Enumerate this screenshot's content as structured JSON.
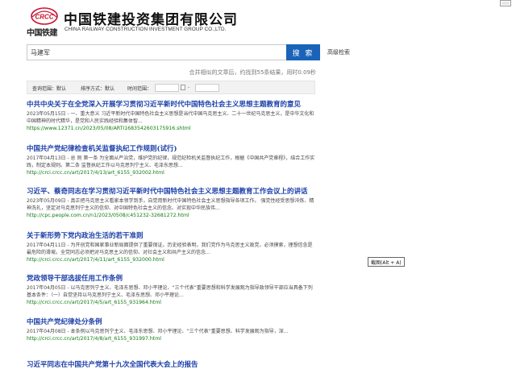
{
  "header": {
    "logo_text": "中国铁建",
    "logo_emblem_text": "CRCC",
    "company_cn": "中国铁建投资集团有限公司",
    "company_en": "CHINA RAILWAY CONSTRUCTION INVESTMENT GROUP CO.,LTD."
  },
  "search": {
    "query": "马建军",
    "button_label": "搜 索",
    "advanced_label": "高级检索"
  },
  "stats_text": "合并相似的文章后，约找到55条结果，用时0.09秒",
  "filters": {
    "scope_label": "查询范围：默认",
    "sort_label": "排序方式：默认",
    "time_label": "时间范围：",
    "date_separator": "-"
  },
  "results": [
    {
      "title": "中共中央关于在全党深入开展学习贯彻习近平新时代中国特色社会主义思想主题教育的意见",
      "snippet": "2023年05月15日 - 一、重大意义 习近平新时代中国特色社会主义思想是当代中国马克思主义、二十一世纪马克思主义，是中华文化和中国精神的时代精华，是党和人民实践经验和集体智...",
      "url": "https://www.12371.cn/2023/05/08/ARTI1683542603175916.shtml"
    },
    {
      "title": "中国共产党纪律检查机关监督执纪工作规则(试行)",
      "snippet": "2017年04月13日 - 总 则 第一条 为全面从严治党，维护党的纪律，规范纪检机关监督执纪工作，根据《中国共产党章程》，结合工作实践，制定本规则。第二条 监督执纪工作以马克思列宁主义、毛泽东思想...",
      "url": "http://crci.crcc.cn/art/2017/4/13/art_6155_932002.html"
    },
    {
      "title": "习近平、蔡奇同志在学习贯彻习近平新时代中国特色社会主义思想主题教育工作会议上的讲话",
      "snippet": "2023年05月09日 - 真正把马克思主义看家本领学到手，自觉用新时代中国特色社会主义思想指导各项工作。 强党性经受思想淬炼、精神洗礼，坚定对马克思列宁主义的信仰、对中国特色社会主义的信念、对实现中华民族伟...",
      "url": "http://cpc.people.com.cn/n1/2023/0508/c451232-32681272.html"
    },
    {
      "title": "关于新形势下党内政治生活的若干准则",
      "snippet": "2017年04月11日 - 为开创党和国家事业新局面提供了重要保证。历史经验表明，我们党作为马克思主义政党，必须摸索，理想信念是最危险的滑坡。全党同志必须把对马克思主义的信仰、对社会主义和共产主义的信念...",
      "url": "http://crci.crcc.cn/art/2017/4/11/art_6155_932000.html"
    },
    {
      "title": "党政领导干部选拔任用工作条例",
      "snippet": "2017年04月05日 - 以马克思列宁主义、毛泽东思想、邓小平理论、“三个代表”重要思想和科学发展观为指导政领导干部应当具备下列基本条件：（一）自觉坚持以马克思列宁主义、毛泽东思想、邓小平理论...",
      "url": "http://crci.crcc.cn/art/2017/4/5/art_6155_931964.html"
    },
    {
      "title": "中国共产党纪律处分条例",
      "snippet": "2017年04月08日 - 本条例以马克思列宁主义、毛泽东思想、邓小平理论、“三个代表”重要思想、科学发展观为指导，深...",
      "url": "http://crci.crcc.cn/art/2017/4/8/art_6155_931997.html"
    },
    {
      "title": "习近平同志在中国共产党第十九次全国代表大会上的报告",
      "snippet": "",
      "url": ""
    }
  ],
  "tooltip_text": "截图(Alt + A)",
  "colors": {
    "title_link": "#1b3fa8",
    "url_green": "#0f7a0f",
    "search_button": "#1a63b8",
    "logo_red": "#c8102e"
  }
}
